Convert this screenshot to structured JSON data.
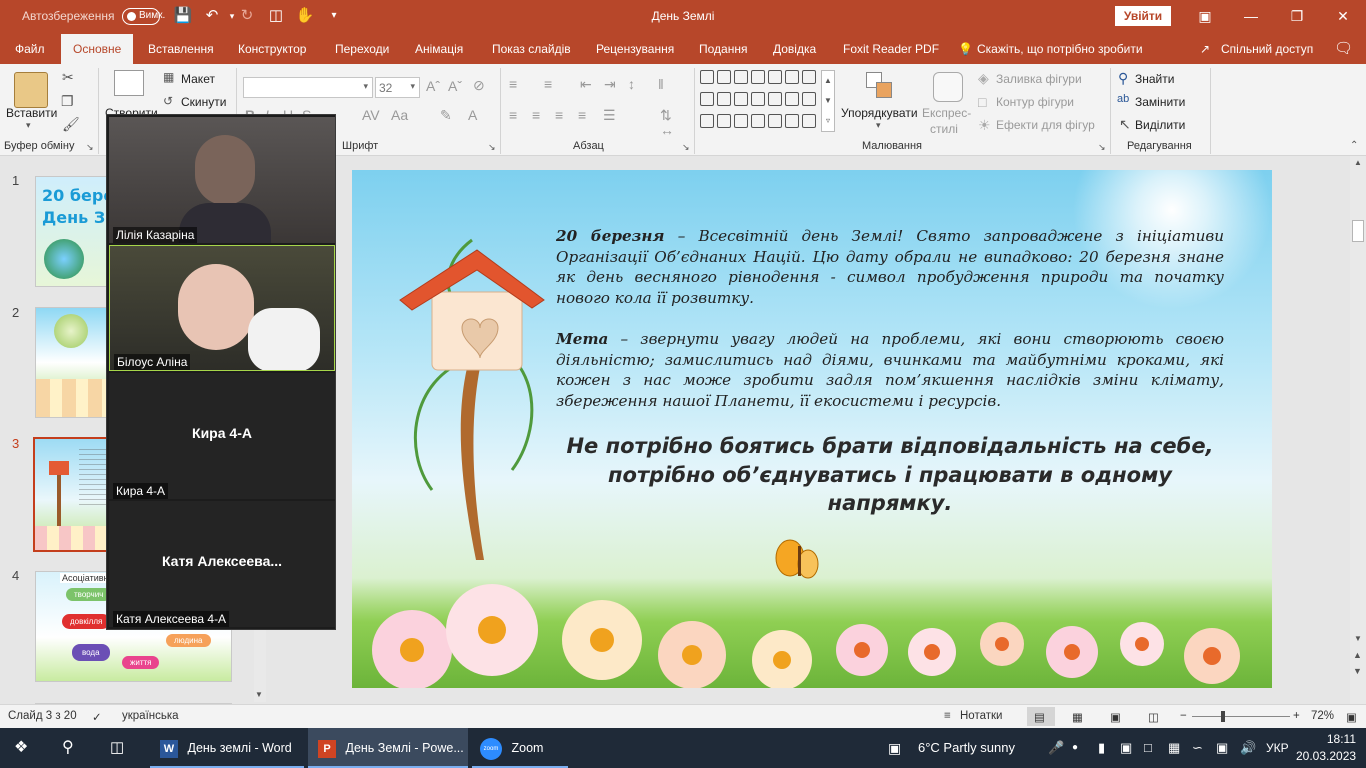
{
  "titlebar": {
    "autosave_label": "Автозбереження",
    "autosave_state": "Вимк.",
    "doc_title": "День Землі",
    "signin_label": "Увійти"
  },
  "tabs": [
    "Файл",
    "Основне",
    "Вставлення",
    "Конструктор",
    "Переходи",
    "Анімація",
    "Показ слайдів",
    "Рецензування",
    "Подання",
    "Довідка",
    "Foxit Reader PDF"
  ],
  "tell_me": "Скажіть, що потрібно зробити",
  "share": "Спільний доступ",
  "ribbon": {
    "paste": "Вставити",
    "clipboard_group": "Буфер обміну",
    "new_slide": "Створити",
    "layout": "Макет",
    "reset": "Скинути",
    "font_size": "32",
    "font_group": "Шрифт",
    "paragraph_group": "Абзац",
    "arrange": "Упорядкувати",
    "quick_styles_1": "Експрес-",
    "quick_styles_2": "стилі",
    "shape_fill": "Заливка фігури",
    "shape_outline": "Контур фігури",
    "shape_effects": "Ефекти для фігур",
    "drawing_group": "Малювання",
    "find": "Знайти",
    "replace": "Замінити",
    "select": "Виділити",
    "editing_group": "Редагування"
  },
  "thumbnails": [
    {
      "num": "1",
      "text": "20 березн\nДень Зем"
    },
    {
      "num": "2",
      "text": ""
    },
    {
      "num": "3",
      "text": ""
    },
    {
      "num": "4",
      "text": "Асоціативни",
      "bubbles": [
        "творчич",
        "довкілля",
        "вода",
        "життя",
        "людина"
      ]
    }
  ],
  "zoom": {
    "participants": [
      {
        "name": "Лілія Казаріна",
        "video": true
      },
      {
        "name": "Білоус Аліна",
        "video": true,
        "speaking": true
      },
      {
        "name": "Кира 4-А",
        "center": "Кира 4-А",
        "video": false
      },
      {
        "name": "Катя Алексеева 4-А",
        "center": "Катя  Алексеева...",
        "video": false
      }
    ]
  },
  "slide": {
    "p1_bold": "20 березня",
    "p1_rest": " – Всесвітній день Землі! Свято запроваджене з ініціативи Організації Об’єднаних Націй. Цю дату обрали не випадково: 20 березня знане як день весняного рівнодення - символ пробудження природи та початку нового кола її розвитку.",
    "p2_bold": "Мета",
    "p2_rest": " – звернути увагу людей на проблеми, які вони створюють своєю діяльністю; замислитись над діями, вчинками та майбутніми кроками, які кожен з нас може зробити задля пом’якшення наслідків зміни клімату, збереження нашої Планети, її екосистеми і ресурсів.",
    "quote": "Не потрібно боятись брати відповідальність на себе, потрібно об’єднуватись і працювати в одному напрямку."
  },
  "statusbar": {
    "slide_info": "Слайд 3 з 20",
    "language": "українська",
    "notes": "Нотатки",
    "zoom_level": "72%"
  },
  "taskbar": {
    "apps": [
      {
        "label": "День землі - Word"
      },
      {
        "label": "День Землі - Powe..."
      },
      {
        "label": "Zoom"
      }
    ],
    "weather": "6°C  Partly sunny",
    "lang": "УКР",
    "time": "18:11",
    "date": "20.03.2023"
  },
  "colors": {
    "accent": "#b7472a",
    "active_thumb": "#c43e1c",
    "taskbar": "#1f2a38",
    "zoom_speaking": "#a7d64a"
  }
}
